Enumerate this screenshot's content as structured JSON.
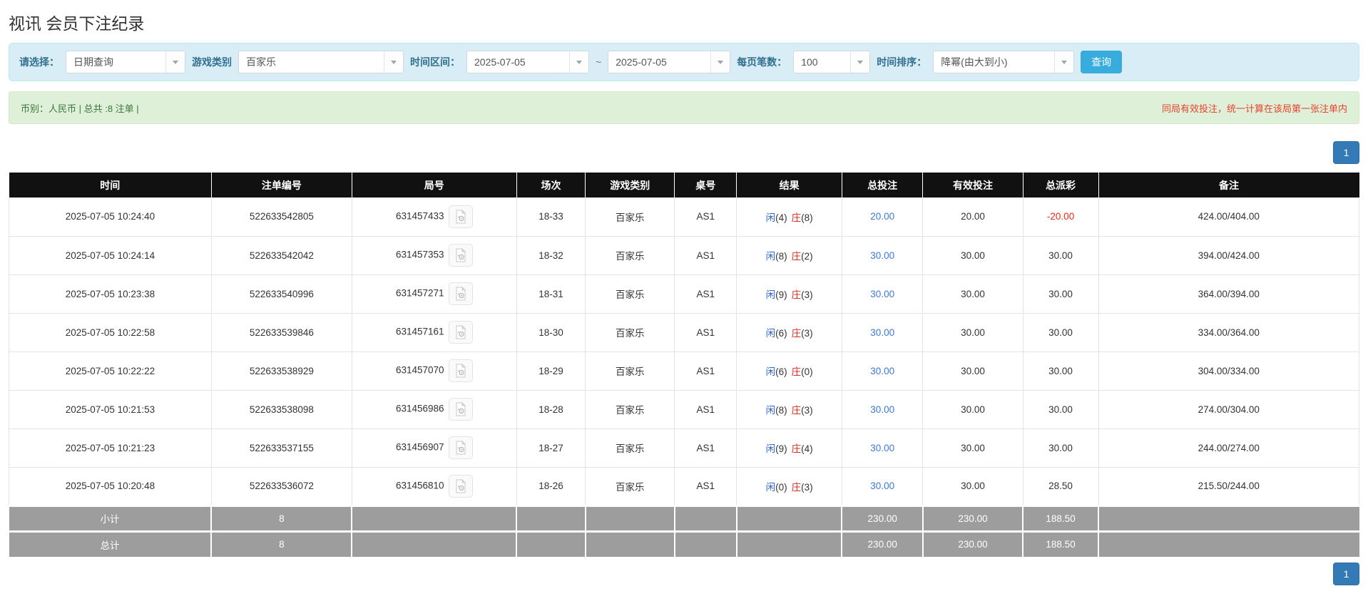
{
  "page": {
    "title": "视讯 会员下注纪录"
  },
  "filters": {
    "select_label": "请选择：",
    "select_value": "日期查询",
    "game_type_label": "游戏类别",
    "game_type_value": "百家乐",
    "time_range_label": "时间区间：",
    "date_from": "2025-07-05",
    "range_separator": "~",
    "date_to": "2025-07-05",
    "page_size_label": "每页笔数：",
    "page_size_value": "100",
    "sort_label": "时间排序：",
    "sort_value": "降幂(由大到小)",
    "search_button": "查询"
  },
  "info_bar": {
    "left_text": "币别：人民币 | 总共 :8 注单 |",
    "right_notice": "同局有效投注，统一计算在该局第一张注单内"
  },
  "pagination": {
    "page": "1"
  },
  "colors": {
    "filter_bg": "#d9edf7",
    "filter_label": "#31708f",
    "search_button": "#38acdc",
    "info_bg": "#dff0d8",
    "info_text": "#3c763d",
    "notice_red": "#e8412f",
    "header_bg": "#111111",
    "player_blue": "#3366cc",
    "banker_red": "#dd2c20",
    "link_blue": "#3c78dc",
    "negative_red": "#f3251d",
    "summary_bg": "#9d9d9d",
    "pager_blue": "#337ab7"
  },
  "table": {
    "headers": [
      "时间",
      "注单编号",
      "局号",
      "场次",
      "游戏类别",
      "桌号",
      "结果",
      "总投注",
      "有效投注",
      "总派彩",
      "备注"
    ],
    "rows": [
      {
        "time": "2025-07-05 10:24:40",
        "bet_id": "522633542805",
        "round_id": "631457433",
        "session": "18-33",
        "game": "百家乐",
        "table_no": "AS1",
        "result": {
          "player": "闲",
          "player_num": "(4)",
          "banker": "庄",
          "banker_num": "(8)"
        },
        "total_bet": "20.00",
        "valid_bet": "20.00",
        "payout": "-20.00",
        "note": "424.00/404.00"
      },
      {
        "time": "2025-07-05 10:24:14",
        "bet_id": "522633542042",
        "round_id": "631457353",
        "session": "18-32",
        "game": "百家乐",
        "table_no": "AS1",
        "result": {
          "player": "闲",
          "player_num": "(8)",
          "banker": "庄",
          "banker_num": "(2)"
        },
        "total_bet": "30.00",
        "valid_bet": "30.00",
        "payout": "30.00",
        "note": "394.00/424.00"
      },
      {
        "time": "2025-07-05 10:23:38",
        "bet_id": "522633540996",
        "round_id": "631457271",
        "session": "18-31",
        "game": "百家乐",
        "table_no": "AS1",
        "result": {
          "player": "闲",
          "player_num": "(9)",
          "banker": "庄",
          "banker_num": "(3)"
        },
        "total_bet": "30.00",
        "valid_bet": "30.00",
        "payout": "30.00",
        "note": "364.00/394.00"
      },
      {
        "time": "2025-07-05 10:22:58",
        "bet_id": "522633539846",
        "round_id": "631457161",
        "session": "18-30",
        "game": "百家乐",
        "table_no": "AS1",
        "result": {
          "player": "闲",
          "player_num": "(6)",
          "banker": "庄",
          "banker_num": "(3)"
        },
        "total_bet": "30.00",
        "valid_bet": "30.00",
        "payout": "30.00",
        "note": "334.00/364.00"
      },
      {
        "time": "2025-07-05 10:22:22",
        "bet_id": "522633538929",
        "round_id": "631457070",
        "session": "18-29",
        "game": "百家乐",
        "table_no": "AS1",
        "result": {
          "player": "闲",
          "player_num": "(6)",
          "banker": "庄",
          "banker_num": "(0)"
        },
        "total_bet": "30.00",
        "valid_bet": "30.00",
        "payout": "30.00",
        "note": "304.00/334.00"
      },
      {
        "time": "2025-07-05 10:21:53",
        "bet_id": "522633538098",
        "round_id": "631456986",
        "session": "18-28",
        "game": "百家乐",
        "table_no": "AS1",
        "result": {
          "player": "闲",
          "player_num": "(8)",
          "banker": "庄",
          "banker_num": "(3)"
        },
        "total_bet": "30.00",
        "valid_bet": "30.00",
        "payout": "30.00",
        "note": "274.00/304.00"
      },
      {
        "time": "2025-07-05 10:21:23",
        "bet_id": "522633537155",
        "round_id": "631456907",
        "session": "18-27",
        "game": "百家乐",
        "table_no": "AS1",
        "result": {
          "player": "闲",
          "player_num": "(9)",
          "banker": "庄",
          "banker_num": "(4)"
        },
        "total_bet": "30.00",
        "valid_bet": "30.00",
        "payout": "30.00",
        "note": "244.00/274.00"
      },
      {
        "time": "2025-07-05 10:20:48",
        "bet_id": "522633536072",
        "round_id": "631456810",
        "session": "18-26",
        "game": "百家乐",
        "table_no": "AS1",
        "result": {
          "player": "闲",
          "player_num": "(0)",
          "banker": "庄",
          "banker_num": "(3)"
        },
        "total_bet": "30.00",
        "valid_bet": "30.00",
        "payout": "28.50",
        "note": "215.50/244.00"
      }
    ],
    "subtotal": {
      "label": "小计",
      "count": "8",
      "total_bet": "230.00",
      "valid_bet": "230.00",
      "payout": "188.50"
    },
    "total": {
      "label": "总计",
      "count": "8",
      "total_bet": "230.00",
      "valid_bet": "230.00",
      "payout": "188.50"
    }
  }
}
